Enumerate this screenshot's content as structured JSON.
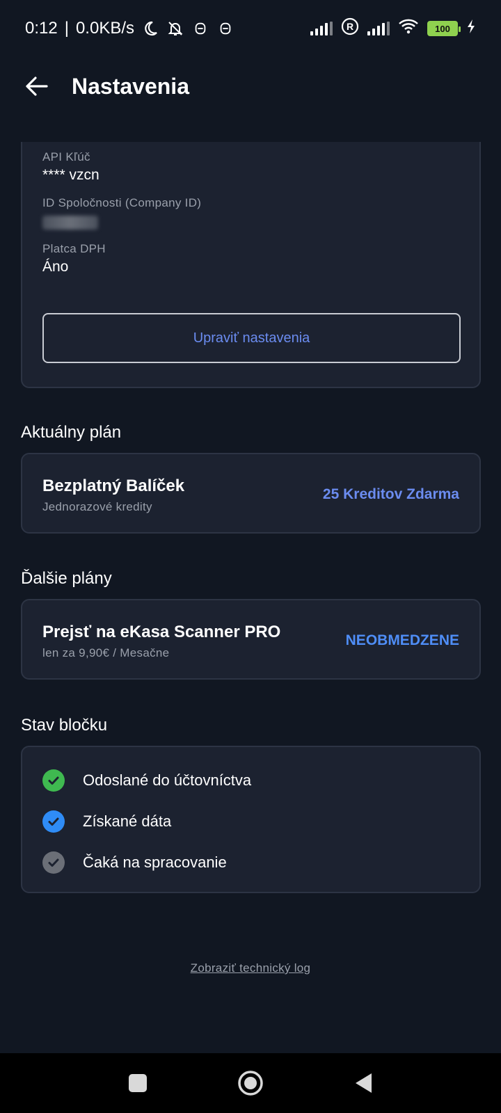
{
  "status_bar": {
    "time": "0:12",
    "speed": "0.0KB/s",
    "battery": "100",
    "icons": [
      "moon-icon",
      "bell-off-icon",
      "notification-icon",
      "notification-icon",
      "signal-icon",
      "registered-icon",
      "signal-icon",
      "wifi-icon",
      "battery-icon",
      "charging-icon"
    ]
  },
  "app_bar": {
    "title": "Nastavenia",
    "back_icon": "arrow-left-icon"
  },
  "settings": {
    "api_key_label": "API Kľúč",
    "api_key_value": "**** vzcn",
    "company_id_label": "ID Spoločnosti (Company ID)",
    "vat_payer_label": "Platca DPH",
    "vat_payer_value": "Áno",
    "edit_button": "Upraviť nastavenia"
  },
  "current_plan": {
    "heading": "Aktuálny plán",
    "title": "Bezplatný Balíček",
    "subtitle": "Jednorazové kredity",
    "badge": "25 Kreditov Zdarma",
    "badge_color": "#6b8cf0"
  },
  "other_plans": {
    "heading": "Ďalšie plány",
    "title": "Prejsť na eKasa Scanner PRO",
    "subtitle": "len za 9,90€ / Mesačne",
    "badge": "NEOBMEDZENE",
    "badge_color": "#4f8ef7"
  },
  "receipt_status": {
    "heading": "Stav bločku",
    "items": [
      {
        "label": "Odoslané do účtovníctva",
        "color": "#3fb950",
        "icon": "check-circle-icon"
      },
      {
        "label": "Získané dáta",
        "color": "#2f8cf6",
        "icon": "check-circle-icon"
      },
      {
        "label": "Čaká na spracovanie",
        "color": "#6b6f77",
        "icon": "check-circle-icon"
      }
    ]
  },
  "footer": {
    "tech_log_link": "Zobraziť technický log"
  },
  "nav_bar": {
    "icons": [
      "recent-apps-icon",
      "home-icon",
      "back-icon"
    ]
  }
}
